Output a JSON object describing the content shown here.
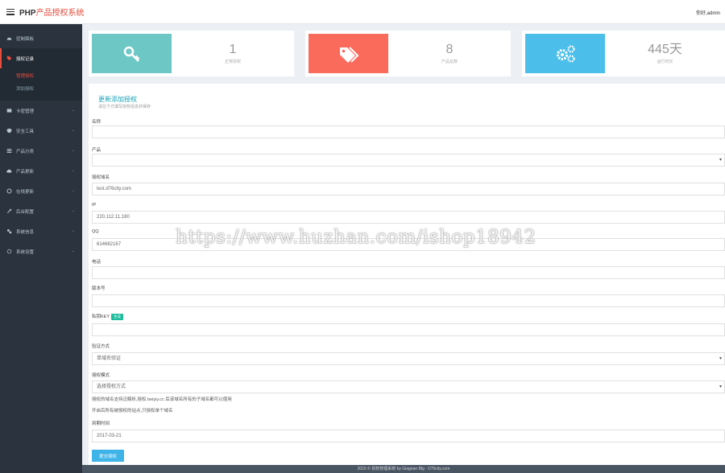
{
  "header": {
    "brand_prefix": "PHP",
    "brand_accent": "产品授权系统",
    "user_menu": "你好,admin"
  },
  "sidebar": {
    "items": [
      {
        "label": "控制面板",
        "icon": "dashboard-icon"
      },
      {
        "label": "授权记录",
        "icon": "tag-icon"
      },
      {
        "label": "卡密管理",
        "icon": "card-icon"
      },
      {
        "label": "安全工具",
        "icon": "shield-icon"
      },
      {
        "label": "产品分类",
        "icon": "list-icon"
      },
      {
        "label": "产品更新",
        "icon": "cloud-icon"
      },
      {
        "label": "在线更新",
        "icon": "refresh-icon"
      },
      {
        "label": "后台配置",
        "icon": "settings-icon"
      },
      {
        "label": "系统信息",
        "icon": "info-icon"
      },
      {
        "label": "系统设置",
        "icon": "gear-icon"
      }
    ],
    "subitems": [
      "管理授权",
      "添加授权"
    ]
  },
  "stats": [
    {
      "value": "1",
      "label": "正常授权",
      "icon": "key-icon",
      "color": "#6cc7c5"
    },
    {
      "value": "8",
      "label": "产品总数",
      "icon": "tags-icon",
      "color": "#fa6b5c"
    },
    {
      "value": "445天",
      "label": "运行时长",
      "icon": "cogs-icon",
      "color": "#4bbfea"
    }
  ],
  "form": {
    "title": "更新添加授权",
    "subtitle": "请在下方填写授权信息并保存",
    "fields": {
      "name": {
        "label": "名称",
        "value": ""
      },
      "product": {
        "label": "产品",
        "value": ""
      },
      "domain": {
        "label": "授权域名",
        "value": "test.d76city.com"
      },
      "ip": {
        "label": "IP",
        "value": "220.112.11.180"
      },
      "qq": {
        "label": "QQ",
        "value": "614682167"
      },
      "phone": {
        "label": "电话",
        "value": ""
      },
      "version": {
        "label": "版本号",
        "value": ""
      },
      "key": {
        "label": "私钥KEY",
        "tag": "生成",
        "value": ""
      },
      "method": {
        "label": "验证方式",
        "value": "单域名验证"
      },
      "mode": {
        "label": "授权模式",
        "value": "选择授权方式"
      }
    },
    "help_1": "授权的域名支持泛解析,授权 beiyiy.cc 后该域名所有的子域名都可以使用",
    "help_2": "开启后所有被授权的站点,只授权单个域名",
    "expiry": {
      "label": "到期时间",
      "value": "2017-03-21"
    },
    "submit_label": "提交授权"
  },
  "watermark": "https://www.huzhan.com/ishop18942",
  "footer": "2015 © 授权管理系统 by Giagean Blg · D76city.com"
}
